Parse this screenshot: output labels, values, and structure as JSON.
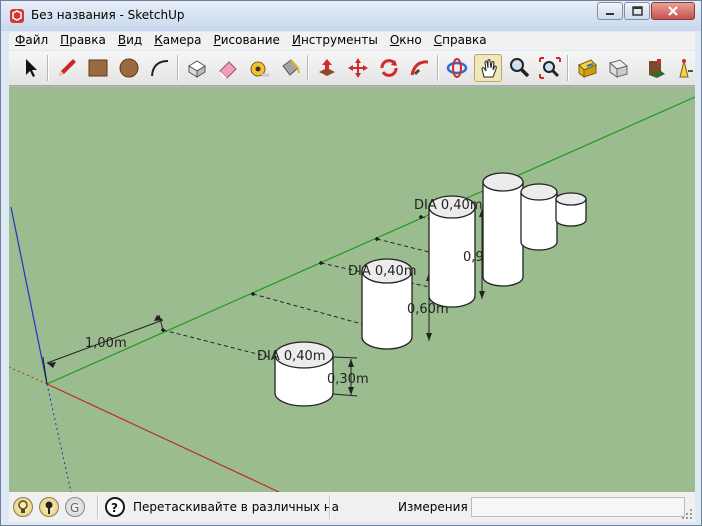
{
  "window": {
    "title": "Без названия - SketchUp"
  },
  "menu": {
    "items": [
      {
        "label": "Файл",
        "mnemonic": "Ф",
        "rest": "айл"
      },
      {
        "label": "Правка",
        "mnemonic": "П",
        "rest": "равка"
      },
      {
        "label": "Вид",
        "mnemonic": "В",
        "rest": "ид"
      },
      {
        "label": "Камера",
        "mnemonic": "К",
        "rest": "амера"
      },
      {
        "label": "Рисование",
        "mnemonic": "Р",
        "rest": "исование"
      },
      {
        "label": "Инструменты",
        "mnemonic": "И",
        "rest": "нструменты"
      },
      {
        "label": "Окно",
        "mnemonic": "О",
        "rest": "кно"
      },
      {
        "label": "Справка",
        "mnemonic": "С",
        "rest": "правка"
      }
    ]
  },
  "toolbar": {
    "tools": [
      "select-tool-icon",
      "pencil-line-tool-icon",
      "rectangle-tool-icon",
      "circle-tool-icon",
      "arc-tool-icon",
      "make-component-tool-icon",
      "eraser-tool-icon",
      "tape-measure-tool-icon",
      "paint-bucket-tool-icon",
      "push-pull-tool-icon",
      "move-tool-icon",
      "rotate-tool-icon",
      "follow-me-tool-icon",
      "orbit-tool-icon",
      "pan-tool-icon",
      "zoom-tool-icon",
      "zoom-extents-tool-icon",
      "warehouse-tool-icon",
      "share-model-tool-icon",
      "components-tool-icon",
      "extension-tool-icon"
    ],
    "active_tool": "pan-tool-icon"
  },
  "viewport": {
    "background": "#9bbc8e",
    "dimensions": {
      "spacing": "1,00m",
      "cyl1_height": "0,30m",
      "cyl2_height": "0,60m",
      "cyl3_height": "0,90m",
      "dia1": "DIA 0,40m",
      "dia2": "DIA 0,40m",
      "dia3": "DIA 0,40m"
    },
    "axis_colors": {
      "green": "#1f9b1f",
      "red": "#c02a2a",
      "blue": "#1c35c9"
    }
  },
  "statusbar": {
    "hint": "Перетаскивайте в различных на",
    "measurements_label": "Измерения",
    "measurements_value": ""
  }
}
